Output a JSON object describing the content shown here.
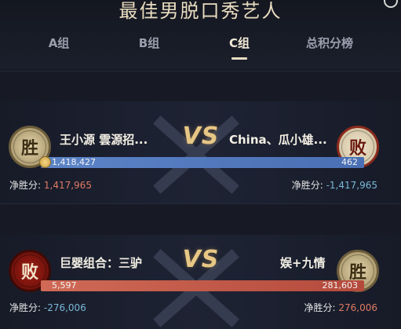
{
  "page": {
    "title": "最佳男脱口秀艺人"
  },
  "tabs": [
    {
      "label": "A组",
      "active": false
    },
    {
      "label": "B组",
      "active": false
    },
    {
      "label": "C组",
      "active": true
    },
    {
      "label": "总积分榜",
      "active": false
    }
  ],
  "matches": [
    {
      "left": {
        "name": "王小源 雲源招...",
        "result": "胜",
        "score": "1,418,427",
        "net_label": "净胜分:",
        "net_value": "1,417,965"
      },
      "vs": "VS",
      "right": {
        "name": "China、瓜小雄...",
        "result": "败",
        "score": "462",
        "net_label": "净胜分:",
        "net_value": "-1,417,965"
      },
      "bar_fill": 0.9997
    },
    {
      "left": {
        "name": "巨婴组合：三驴",
        "result": "败",
        "score": "5,597",
        "net_label": "净胜分:",
        "net_value": "-276,006"
      },
      "vs": "VS",
      "right": {
        "name": "娱+九情",
        "result": "胜",
        "score": "281,603",
        "net_label": "净胜分:",
        "net_value": "276,006"
      },
      "bar_fill": 0.02
    }
  ],
  "colors": {
    "accent": "#e9dcc0",
    "bar_blue": "#5c84c7",
    "bar_red": "#d06a56",
    "positive": "#e07a62",
    "negative": "#7ab8d8"
  }
}
